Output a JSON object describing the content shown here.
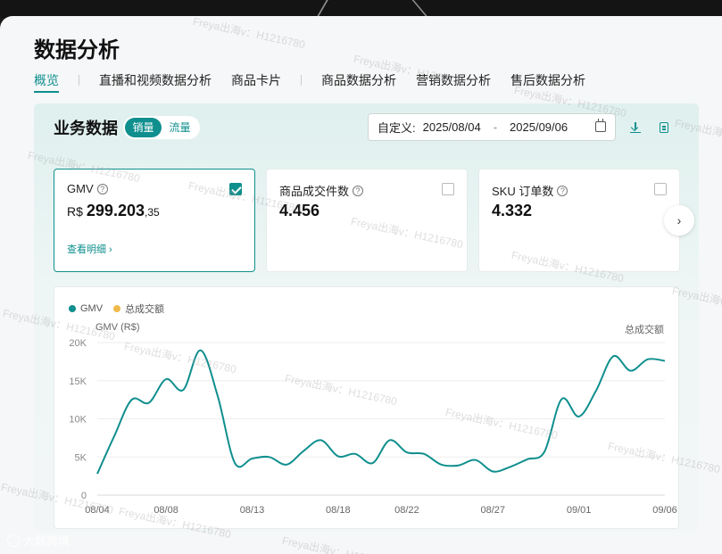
{
  "page": {
    "title": "数据分析",
    "tabs": [
      {
        "label": "概览",
        "active": true
      },
      {
        "label": "直播和视频数据分析",
        "active": false
      },
      {
        "label": "商品卡片",
        "active": false
      },
      {
        "label": "商品数据分析",
        "active": false
      },
      {
        "label": "营销数据分析",
        "active": false
      },
      {
        "label": "售后数据分析",
        "active": false
      }
    ]
  },
  "business": {
    "title": "业务数据",
    "toggle": {
      "sales": "销量",
      "traffic": "流量",
      "selected": "sales"
    },
    "date_range": {
      "label": "自定义:",
      "start": "2025/08/04",
      "separator": "-",
      "end": "2025/09/06"
    },
    "icons": [
      "download-icon",
      "document-icon",
      "calendar-icon",
      "chevron-right-icon"
    ]
  },
  "metrics": [
    {
      "name": "GMV",
      "currency": "R$",
      "value_int": "299.203",
      "value_dec": ",35",
      "link": "查看明细 ›",
      "checked": true
    },
    {
      "name": "商品成交件数",
      "value": "4.456",
      "checked": false
    },
    {
      "name": "SKU 订单数",
      "value": "4.332",
      "checked": false
    }
  ],
  "colors": {
    "accent": "#0f8f8e",
    "series2": "#f0b94b"
  },
  "chart_data": {
    "type": "line",
    "legend": [
      {
        "name": "GMV",
        "color": "#0f8f8e"
      },
      {
        "name": "总成交额",
        "color": "#f0b94b"
      }
    ],
    "ylabel": "GMV (R$)",
    "ylabel_right": "总成交额",
    "y_ticks": [
      "0",
      "5K",
      "10K",
      "15K",
      "20K"
    ],
    "ylim": [
      0,
      20000
    ],
    "x_tick_labels": [
      "08/04",
      "08/08",
      "08/13",
      "08/18",
      "08/22",
      "08/27",
      "09/01",
      "09/06"
    ],
    "x_tick_index": [
      0,
      4,
      9,
      14,
      18,
      23,
      28,
      33
    ],
    "series": [
      {
        "name": "GMV",
        "values": [
          2800,
          7800,
          12500,
          12100,
          15200,
          13800,
          19000,
          13000,
          4200,
          4800,
          5000,
          4000,
          5800,
          7200,
          5100,
          5400,
          4200,
          7200,
          5600,
          5400,
          4000,
          3900,
          4600,
          3100,
          3700,
          4700,
          5700,
          12600,
          10300,
          13700,
          18200,
          16300,
          17800,
          17600
        ]
      }
    ]
  },
  "watermark": "Freya出海v：H1216780",
  "logo": "大数跨境"
}
